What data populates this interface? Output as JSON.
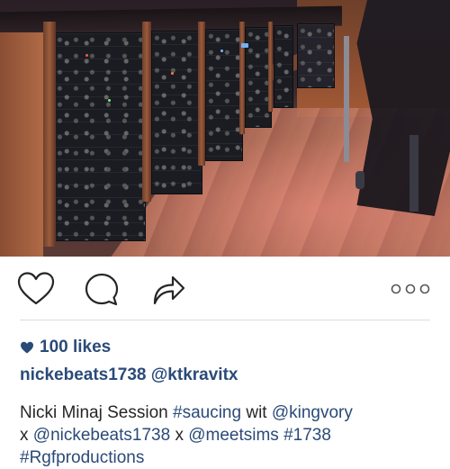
{
  "post": {
    "image_alt": "Recording studio with outboard rack gear and wooden floor",
    "likes_text": "100 likes",
    "tagged_user": "nickebeats1738",
    "tagged_mention": "@ktkravitx",
    "caption": {
      "line1": [
        "Nicki Minaj Session ",
        "#saucing",
        " wit ",
        "@kingvory"
      ],
      "line2": [
        "x ",
        "@nickebeats1738",
        " x ",
        "@meetsims",
        " ",
        "#1738"
      ],
      "line3": [
        "#Rgfproductions"
      ]
    }
  },
  "actions": {
    "like_icon": "heart-outline-icon",
    "comment_icon": "comment-bubble-icon",
    "share_icon": "share-arrow-icon",
    "more_icon": "more-dots-icon"
  },
  "colors": {
    "link": "#2a4a78",
    "text": "#262626",
    "icon": "#262626",
    "divider": "#dbdbdb"
  }
}
